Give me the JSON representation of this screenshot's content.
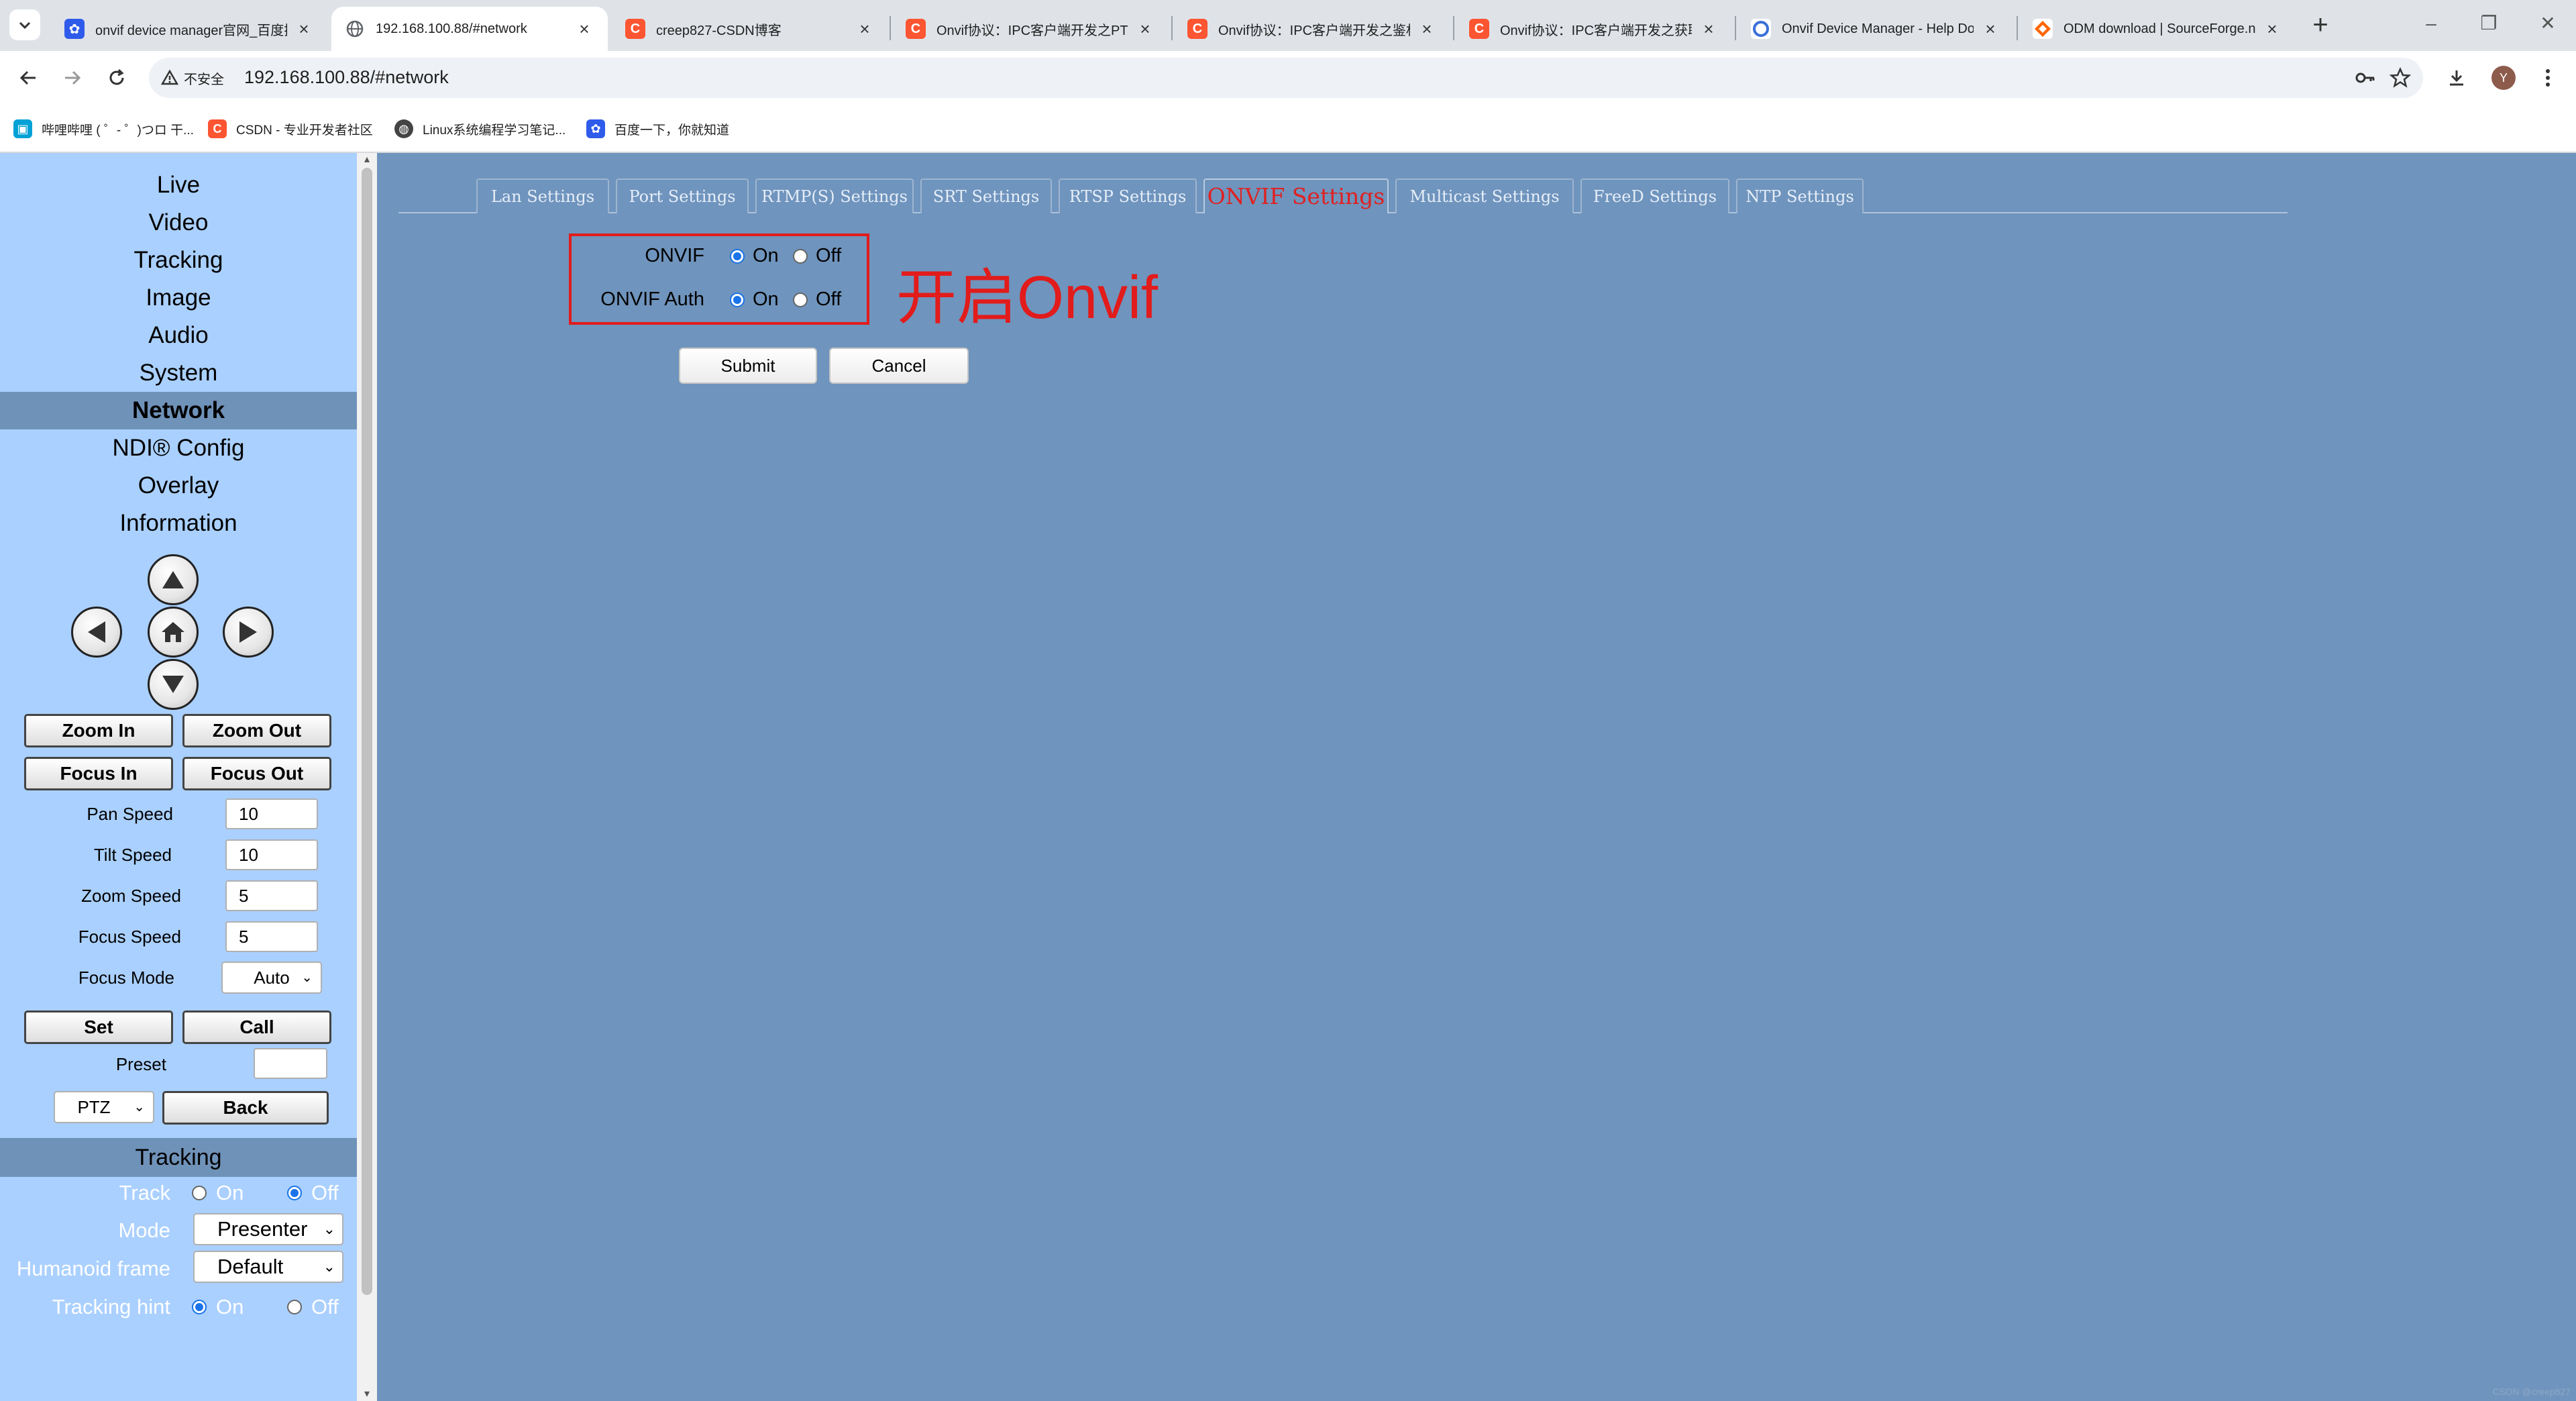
{
  "browser": {
    "tabs": [
      {
        "title": "onvif device manager官网_百度搜",
        "favicon": "baidu-paw",
        "color": "#2f5bea"
      },
      {
        "title": "192.168.100.88/#network",
        "favicon": "globe",
        "color": "#5f6368"
      },
      {
        "title": "creep827-CSDN博客",
        "favicon": "csdn-c",
        "color": "#fc5531"
      },
      {
        "title": "Onvif协议：IPC客户端开发之PTZ",
        "favicon": "csdn-c",
        "color": "#fc5531"
      },
      {
        "title": "Onvif协议：IPC客户端开发之鉴权",
        "favicon": "csdn-c",
        "color": "#fc5531"
      },
      {
        "title": "Onvif协议：IPC客户端开发之获取",
        "favicon": "csdn-c",
        "color": "#fc5531"
      },
      {
        "title": "Onvif Device Manager - Help Do",
        "favicon": "circle-logo",
        "color": "#3b6fd8"
      },
      {
        "title": "ODM download | SourceForge.n",
        "favicon": "sourceforge-diamond",
        "color": "#ff6600"
      }
    ],
    "insecure_label": "不安全",
    "url": "192.168.100.88/#network",
    "avatar_letter": "Y",
    "bookmarks": [
      {
        "label": "哔哩哔哩 ( ゜- ゜)つロ 干...",
        "color": "#00a1d6"
      },
      {
        "label": "CSDN - 专业开发者社区",
        "color": "#fc5531"
      },
      {
        "label": "Linux系统编程学习笔记...",
        "color": "#444444"
      },
      {
        "label": "百度一下，你就知道",
        "color": "#2f5bea"
      }
    ]
  },
  "sidebar": {
    "menu": [
      "Live",
      "Video",
      "Tracking",
      "Image",
      "Audio",
      "System",
      "Network",
      "NDI® Config",
      "Overlay",
      "Information"
    ],
    "active": "Network",
    "buttons": {
      "zoom_in": "Zoom In",
      "zoom_out": "Zoom Out",
      "focus_in": "Focus In",
      "focus_out": "Focus Out",
      "set": "Set",
      "call": "Call",
      "back": "Back"
    },
    "fields": {
      "pan_speed": {
        "label": "Pan Speed",
        "value": "10"
      },
      "tilt_speed": {
        "label": "Tilt Speed",
        "value": "10"
      },
      "zoom_speed": {
        "label": "Zoom Speed",
        "value": "5"
      },
      "focus_speed": {
        "label": "Focus Speed",
        "value": "5"
      },
      "focus_mode": {
        "label": "Focus Mode",
        "value": "Auto"
      },
      "preset": {
        "label": "Preset",
        "value": ""
      },
      "ptz_select": "PTZ"
    },
    "tracking": {
      "header": "Tracking",
      "track_label": "Track",
      "track_value": "Off",
      "mode_label": "Mode",
      "mode_value": "Presenter",
      "humanoid_label": "Humanoid frame",
      "humanoid_value": "Default",
      "hint_label": "Tracking hint",
      "hint_value": "On",
      "on": "On",
      "off": "Off"
    }
  },
  "main": {
    "tabs": [
      "Lan Settings",
      "Port Settings",
      "RTMP(S) Settings",
      "SRT Settings",
      "RTSP Settings",
      "ONVIF Settings",
      "Multicast Settings",
      "FreeD Settings",
      "NTP Settings"
    ],
    "active_tab": "ONVIF Settings",
    "onvif": {
      "label": "ONVIF",
      "value": "On"
    },
    "onvif_auth": {
      "label": "ONVIF Auth",
      "value": "On"
    },
    "on_label": "On",
    "off_label": "Off",
    "annotation": "开启Onvif",
    "submit": "Submit",
    "cancel": "Cancel",
    "watermark": "CSDN @creep827"
  },
  "colors": {
    "sidebar_bg": "#aad0ff",
    "sidebar_active": "#6f92b9",
    "main_bg": "#6f94bd",
    "active_tab_text": "#e02020",
    "annotation_red": "#e21b1b"
  }
}
